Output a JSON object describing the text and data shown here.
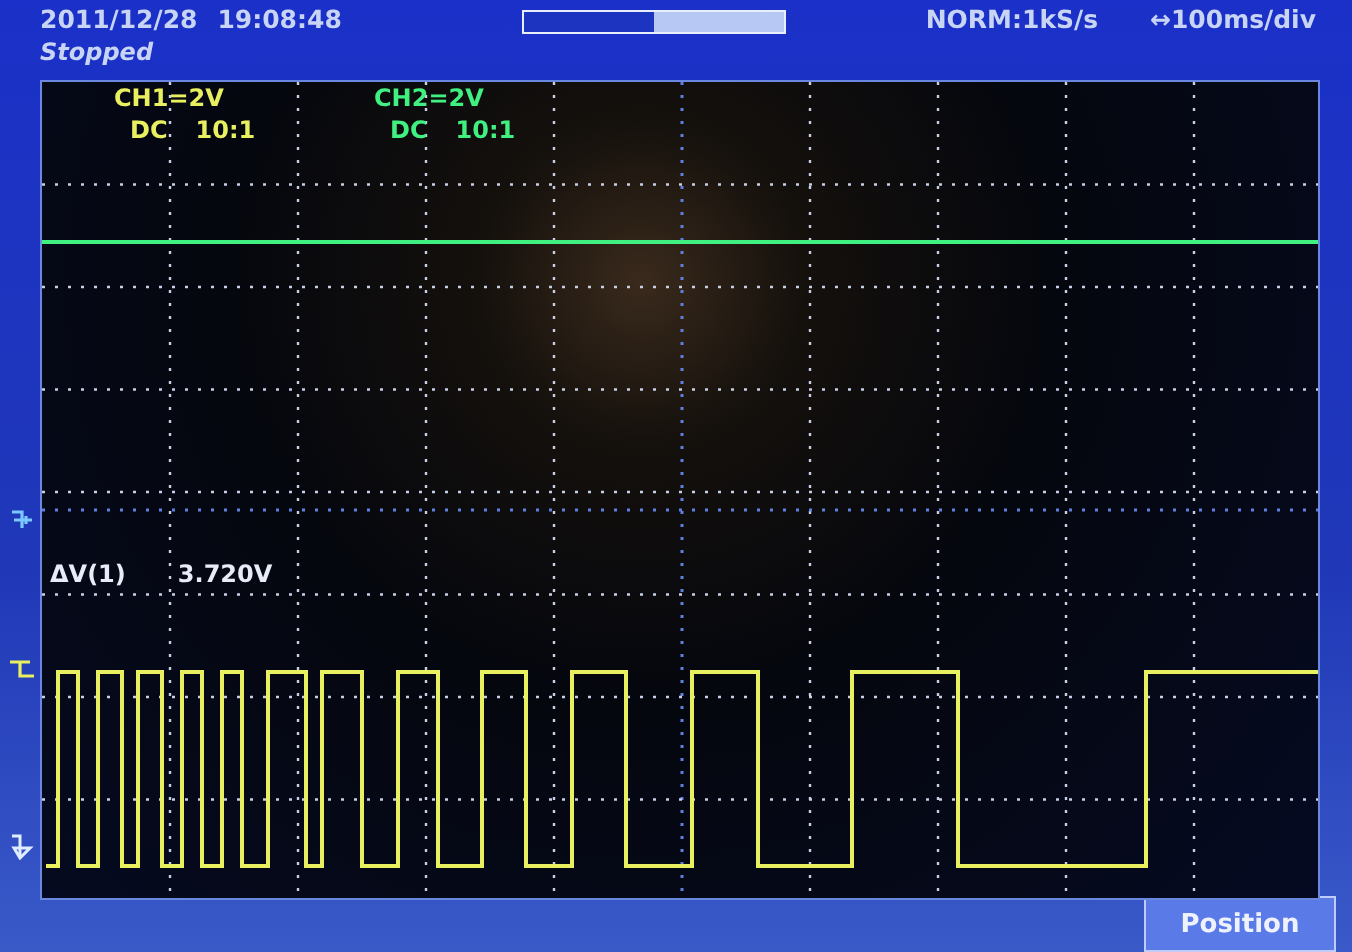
{
  "header": {
    "date": "2011/12/28",
    "time": "19:08:48",
    "status": "Stopped",
    "memory_bar": {
      "level": 0.5
    },
    "sample_rate": "NORM:1kS/s",
    "timebase": "↔100ms/div"
  },
  "channels": [
    {
      "label": "CH1=2V",
      "coupling": "DC",
      "probe": "10:1",
      "color": "#e8f060"
    },
    {
      "label": "CH2=2V",
      "coupling": "DC",
      "probe": "10:1",
      "color": "#40f080"
    }
  ],
  "measurement": {
    "label": "ΔV(1)",
    "value": "3.720V"
  },
  "buttons": [
    "Position"
  ]
}
